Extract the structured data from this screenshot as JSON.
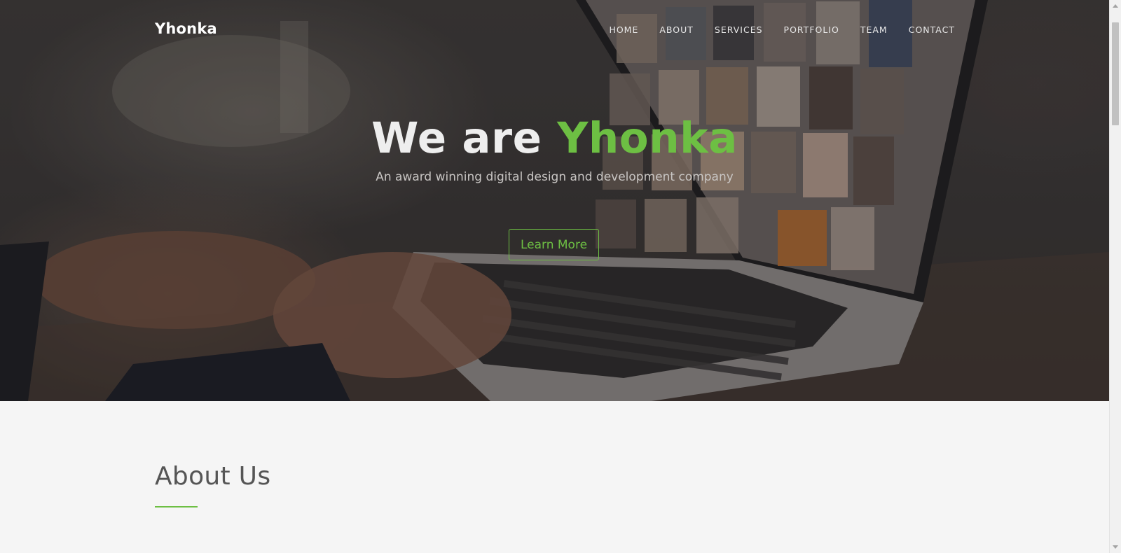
{
  "nav": {
    "brand": "Yhonka",
    "items": [
      {
        "label": "HOME"
      },
      {
        "label": "ABOUT"
      },
      {
        "label": "SERVICES"
      },
      {
        "label": "PORTFOLIO"
      },
      {
        "label": "TEAM"
      },
      {
        "label": "CONTACT"
      }
    ]
  },
  "hero": {
    "title_prefix": "We are ",
    "title_accent": "Yhonka",
    "subtitle": "An award winning digital design and development company",
    "cta_label": "Learn More"
  },
  "about": {
    "title": "About Us"
  },
  "colors": {
    "accent": "#6dbf43",
    "page_background": "#f5f5f5"
  }
}
